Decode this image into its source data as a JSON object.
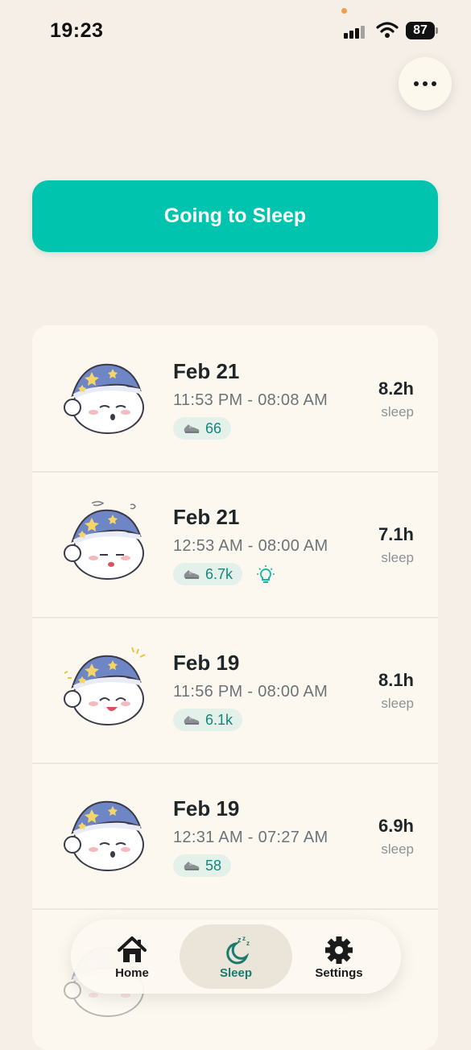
{
  "status_bar": {
    "time": "19:23",
    "battery": "87"
  },
  "header": {
    "more_icon": "ellipsis-icon"
  },
  "primary_action": {
    "label": "Going to Sleep",
    "color": "#00c4ae"
  },
  "sleep_entries": [
    {
      "date": "Feb 21",
      "range": "11:53 PM - 08:08 AM",
      "steps": "66",
      "duration": "8.2h",
      "duration_label": "sleep",
      "mood": "sleepy"
    },
    {
      "date": "Feb 21",
      "range": "12:53 AM - 08:00 AM",
      "steps": "6.7k",
      "duration": "7.1h",
      "duration_label": "sleep",
      "mood": "exhausted",
      "extra_icon": "lightbulb-icon"
    },
    {
      "date": "Feb 19",
      "range": "11:56 PM - 08:00 AM",
      "steps": "6.1k",
      "duration": "8.1h",
      "duration_label": "sleep",
      "mood": "happy"
    },
    {
      "date": "Feb 19",
      "range": "12:31 AM - 07:27 AM",
      "steps": "58",
      "duration": "6.9h",
      "duration_label": "sleep",
      "mood": "sleepy"
    }
  ],
  "tab_bar": {
    "active_tab": "Sleep",
    "tabs": [
      {
        "label": "Home",
        "icon": "house-icon"
      },
      {
        "label": "Sleep",
        "icon": "moon-zzz-icon"
      },
      {
        "label": "Settings",
        "icon": "gear-icon"
      }
    ]
  }
}
